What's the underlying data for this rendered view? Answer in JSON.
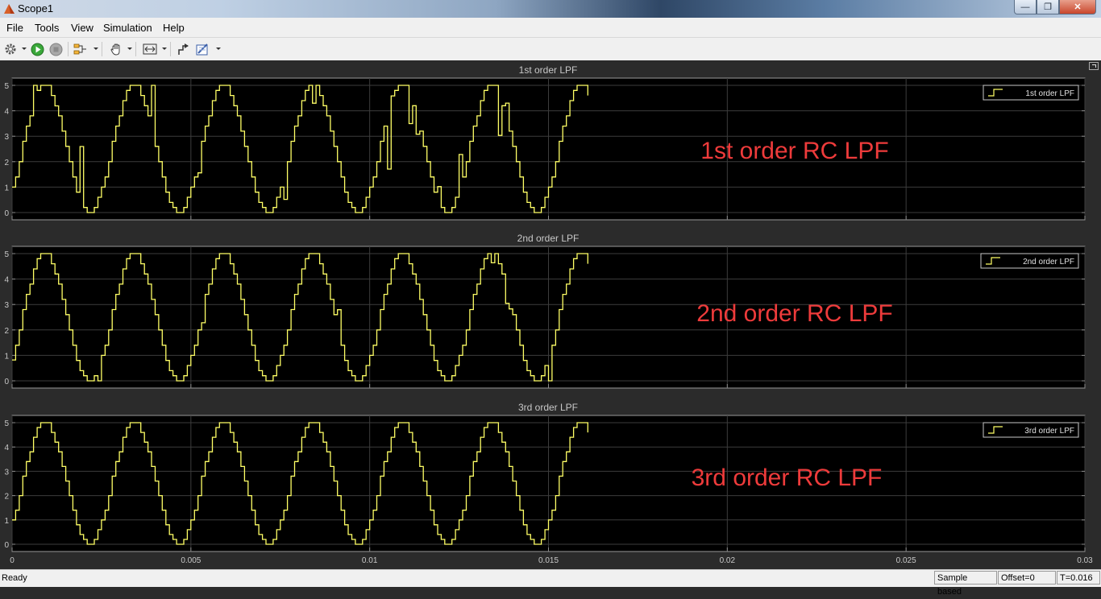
{
  "window": {
    "title": "Scope1"
  },
  "menu": [
    "File",
    "Tools",
    "View",
    "Simulation",
    "Help"
  ],
  "toolbar": {
    "icons": [
      "gear-icon",
      "run-icon",
      "stop-icon",
      "signal-icon",
      "pan-hand-icon",
      "zoom-fit-icon",
      "style-icon",
      "measure-icon"
    ]
  },
  "plots": [
    {
      "title": "1st order LPF",
      "legend": "1st order LPF",
      "annotation": "1st order RC LPF"
    },
    {
      "title": "2nd order LPF",
      "legend": "2nd order LPF",
      "annotation": "2nd order RC LPF"
    },
    {
      "title": "3rd order LPF",
      "legend": "3rd order LPF",
      "annotation": "3rd order RC LPF"
    }
  ],
  "status": {
    "ready": "Ready",
    "mode": "Sample based",
    "offset": "Offset=0",
    "time": "T=0.016"
  },
  "colors": {
    "signal": "#ffff66",
    "annotation": "#ee3b3b",
    "axes_bg": "#000000",
    "figure_bg": "#2b2b2b"
  },
  "chart_data": [
    {
      "type": "line",
      "title": "1st order LPF",
      "series": [
        {
          "name": "1st order LPF",
          "period": 0.0025,
          "min": 0,
          "max": 5,
          "stairs": true,
          "end": 0.01615,
          "noisy": true
        }
      ],
      "xlim": [
        0,
        0.03
      ],
      "ylim": [
        0,
        5
      ],
      "xticks": [
        "0",
        "0.005",
        "0.01",
        "0.015",
        "0.02",
        "0.025",
        "0.03"
      ],
      "yticks": [
        "0",
        "1",
        "2",
        "3",
        "4",
        "5"
      ],
      "grid": true,
      "legend_position": "top-right"
    },
    {
      "type": "line",
      "title": "2nd order LPF",
      "series": [
        {
          "name": "2nd order LPF",
          "period": 0.0025,
          "min": 0,
          "max": 5,
          "stairs": true,
          "end": 0.01615,
          "noisy": true
        }
      ],
      "xlim": [
        0,
        0.03
      ],
      "ylim": [
        0,
        5
      ],
      "xticks": [
        "0",
        "0.005",
        "0.01",
        "0.015",
        "0.02",
        "0.025",
        "0.03"
      ],
      "yticks": [
        "0",
        "1",
        "2",
        "3",
        "4",
        "5"
      ],
      "grid": true,
      "legend_position": "top-right"
    },
    {
      "type": "line",
      "title": "3rd order LPF",
      "series": [
        {
          "name": "3rd order LPF",
          "period": 0.0025,
          "min": 0,
          "max": 5,
          "stairs": true,
          "end": 0.01615,
          "noisy": false
        }
      ],
      "xlim": [
        0,
        0.03
      ],
      "ylim": [
        0,
        5
      ],
      "xticks": [
        "0",
        "0.005",
        "0.01",
        "0.015",
        "0.02",
        "0.025",
        "0.03"
      ],
      "yticks": [
        "0",
        "1",
        "2",
        "3",
        "4",
        "5"
      ],
      "grid": true,
      "legend_position": "top-right"
    }
  ]
}
